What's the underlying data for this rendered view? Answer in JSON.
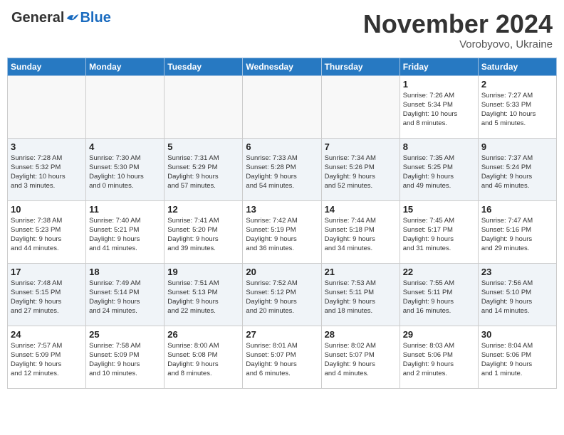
{
  "header": {
    "logo_general": "General",
    "logo_blue": "Blue",
    "month_title": "November 2024",
    "subtitle": "Vorobyovo, Ukraine"
  },
  "weekdays": [
    "Sunday",
    "Monday",
    "Tuesday",
    "Wednesday",
    "Thursday",
    "Friday",
    "Saturday"
  ],
  "weeks": [
    [
      {
        "day": "",
        "info": ""
      },
      {
        "day": "",
        "info": ""
      },
      {
        "day": "",
        "info": ""
      },
      {
        "day": "",
        "info": ""
      },
      {
        "day": "",
        "info": ""
      },
      {
        "day": "1",
        "info": "Sunrise: 7:26 AM\nSunset: 5:34 PM\nDaylight: 10 hours\nand 8 minutes."
      },
      {
        "day": "2",
        "info": "Sunrise: 7:27 AM\nSunset: 5:33 PM\nDaylight: 10 hours\nand 5 minutes."
      }
    ],
    [
      {
        "day": "3",
        "info": "Sunrise: 7:28 AM\nSunset: 5:32 PM\nDaylight: 10 hours\nand 3 minutes."
      },
      {
        "day": "4",
        "info": "Sunrise: 7:30 AM\nSunset: 5:30 PM\nDaylight: 10 hours\nand 0 minutes."
      },
      {
        "day": "5",
        "info": "Sunrise: 7:31 AM\nSunset: 5:29 PM\nDaylight: 9 hours\nand 57 minutes."
      },
      {
        "day": "6",
        "info": "Sunrise: 7:33 AM\nSunset: 5:28 PM\nDaylight: 9 hours\nand 54 minutes."
      },
      {
        "day": "7",
        "info": "Sunrise: 7:34 AM\nSunset: 5:26 PM\nDaylight: 9 hours\nand 52 minutes."
      },
      {
        "day": "8",
        "info": "Sunrise: 7:35 AM\nSunset: 5:25 PM\nDaylight: 9 hours\nand 49 minutes."
      },
      {
        "day": "9",
        "info": "Sunrise: 7:37 AM\nSunset: 5:24 PM\nDaylight: 9 hours\nand 46 minutes."
      }
    ],
    [
      {
        "day": "10",
        "info": "Sunrise: 7:38 AM\nSunset: 5:23 PM\nDaylight: 9 hours\nand 44 minutes."
      },
      {
        "day": "11",
        "info": "Sunrise: 7:40 AM\nSunset: 5:21 PM\nDaylight: 9 hours\nand 41 minutes."
      },
      {
        "day": "12",
        "info": "Sunrise: 7:41 AM\nSunset: 5:20 PM\nDaylight: 9 hours\nand 39 minutes."
      },
      {
        "day": "13",
        "info": "Sunrise: 7:42 AM\nSunset: 5:19 PM\nDaylight: 9 hours\nand 36 minutes."
      },
      {
        "day": "14",
        "info": "Sunrise: 7:44 AM\nSunset: 5:18 PM\nDaylight: 9 hours\nand 34 minutes."
      },
      {
        "day": "15",
        "info": "Sunrise: 7:45 AM\nSunset: 5:17 PM\nDaylight: 9 hours\nand 31 minutes."
      },
      {
        "day": "16",
        "info": "Sunrise: 7:47 AM\nSunset: 5:16 PM\nDaylight: 9 hours\nand 29 minutes."
      }
    ],
    [
      {
        "day": "17",
        "info": "Sunrise: 7:48 AM\nSunset: 5:15 PM\nDaylight: 9 hours\nand 27 minutes."
      },
      {
        "day": "18",
        "info": "Sunrise: 7:49 AM\nSunset: 5:14 PM\nDaylight: 9 hours\nand 24 minutes."
      },
      {
        "day": "19",
        "info": "Sunrise: 7:51 AM\nSunset: 5:13 PM\nDaylight: 9 hours\nand 22 minutes."
      },
      {
        "day": "20",
        "info": "Sunrise: 7:52 AM\nSunset: 5:12 PM\nDaylight: 9 hours\nand 20 minutes."
      },
      {
        "day": "21",
        "info": "Sunrise: 7:53 AM\nSunset: 5:11 PM\nDaylight: 9 hours\nand 18 minutes."
      },
      {
        "day": "22",
        "info": "Sunrise: 7:55 AM\nSunset: 5:11 PM\nDaylight: 9 hours\nand 16 minutes."
      },
      {
        "day": "23",
        "info": "Sunrise: 7:56 AM\nSunset: 5:10 PM\nDaylight: 9 hours\nand 14 minutes."
      }
    ],
    [
      {
        "day": "24",
        "info": "Sunrise: 7:57 AM\nSunset: 5:09 PM\nDaylight: 9 hours\nand 12 minutes."
      },
      {
        "day": "25",
        "info": "Sunrise: 7:58 AM\nSunset: 5:09 PM\nDaylight: 9 hours\nand 10 minutes."
      },
      {
        "day": "26",
        "info": "Sunrise: 8:00 AM\nSunset: 5:08 PM\nDaylight: 9 hours\nand 8 minutes."
      },
      {
        "day": "27",
        "info": "Sunrise: 8:01 AM\nSunset: 5:07 PM\nDaylight: 9 hours\nand 6 minutes."
      },
      {
        "day": "28",
        "info": "Sunrise: 8:02 AM\nSunset: 5:07 PM\nDaylight: 9 hours\nand 4 minutes."
      },
      {
        "day": "29",
        "info": "Sunrise: 8:03 AM\nSunset: 5:06 PM\nDaylight: 9 hours\nand 2 minutes."
      },
      {
        "day": "30",
        "info": "Sunrise: 8:04 AM\nSunset: 5:06 PM\nDaylight: 9 hours\nand 1 minute."
      }
    ]
  ]
}
